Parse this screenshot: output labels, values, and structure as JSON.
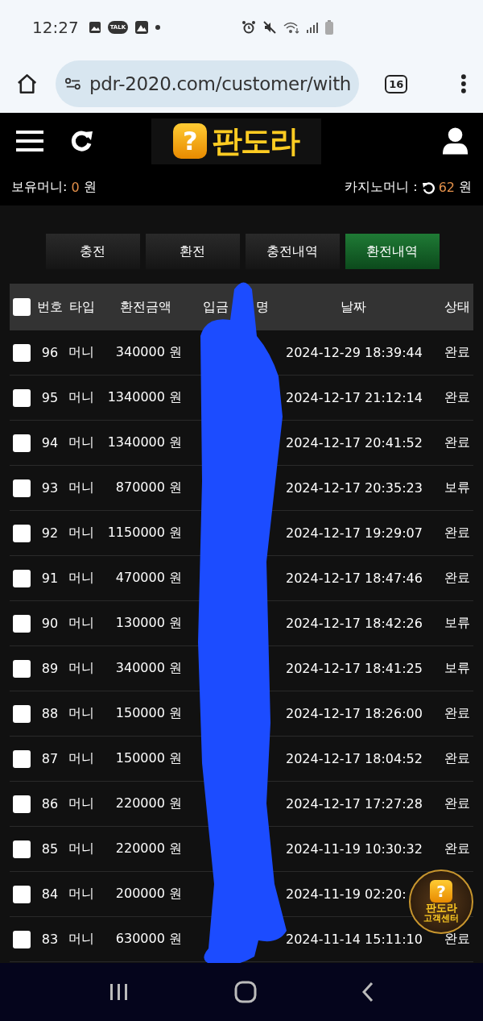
{
  "status_bar": {
    "time": "12:27",
    "chat_badge": "TALK"
  },
  "browser": {
    "url": "pdr-2020.com/customer/with",
    "tab_count": "16"
  },
  "header": {
    "logo": {
      "mark": "?",
      "text": "판도라"
    }
  },
  "balances": {
    "holding_label": "보유머니:",
    "holding_amount": "0",
    "holding_unit": "원",
    "casino_label": "카지노머니 :",
    "casino_amount": "62",
    "casino_unit": "원"
  },
  "tabs": [
    {
      "label": "충전",
      "selected": false
    },
    {
      "label": "환전",
      "selected": false
    },
    {
      "label": "충전내역",
      "selected": false
    },
    {
      "label": "환전내역",
      "selected": true
    }
  ],
  "table": {
    "select_all_checked": false,
    "columns": [
      {
        "label": "번호"
      },
      {
        "label": "타입"
      },
      {
        "label": "환전금액"
      },
      {
        "label_start": "입금",
        "label_end": "명"
      },
      {
        "label": "날짜"
      },
      {
        "label": "상태"
      }
    ],
    "rows": [
      {
        "checked": false,
        "number": "96",
        "type": "머니",
        "amount": "340000 원",
        "date": "2024-12-29 18:39:44",
        "status": "완료"
      },
      {
        "checked": false,
        "number": "95",
        "type": "머니",
        "amount": "1340000 원",
        "date": "2024-12-17 21:12:14",
        "status": "완료"
      },
      {
        "checked": false,
        "number": "94",
        "type": "머니",
        "amount": "1340000 원",
        "date": "2024-12-17 20:41:52",
        "status": "완료"
      },
      {
        "checked": false,
        "number": "93",
        "type": "머니",
        "amount": "870000 원",
        "date": "2024-12-17 20:35:23",
        "status": "보류"
      },
      {
        "checked": false,
        "number": "92",
        "type": "머니",
        "amount": "1150000 원",
        "date": "2024-12-17 19:29:07",
        "status": "완료"
      },
      {
        "checked": false,
        "number": "91",
        "type": "머니",
        "amount": "470000 원",
        "date": "2024-12-17 18:47:46",
        "status": "완료"
      },
      {
        "checked": false,
        "number": "90",
        "type": "머니",
        "amount": "130000 원",
        "date": "2024-12-17 18:42:26",
        "status": "보류"
      },
      {
        "checked": false,
        "number": "89",
        "type": "머니",
        "amount": "340000 원",
        "date": "2024-12-17 18:41:25",
        "status": "보류"
      },
      {
        "checked": false,
        "number": "88",
        "type": "머니",
        "amount": "150000 원",
        "date": "2024-12-17 18:26:00",
        "status": "완료"
      },
      {
        "checked": false,
        "number": "87",
        "type": "머니",
        "amount": "150000 원",
        "date": "2024-12-17 18:04:52",
        "status": "완료"
      },
      {
        "checked": false,
        "number": "86",
        "type": "머니",
        "amount": "220000 원",
        "date": "2024-12-17 17:27:28",
        "status": "완료"
      },
      {
        "checked": false,
        "number": "85",
        "type": "머니",
        "amount": "220000 원",
        "date": "2024-11-19 10:30:32",
        "status": "완료"
      },
      {
        "checked": false,
        "number": "84",
        "type": "머니",
        "amount": "200000 원",
        "date": "2024-11-19 02:20:"
      },
      {
        "checked": false,
        "number": "83",
        "type": "머니",
        "amount": "630000 원",
        "date": "2024-11-14 15:11:10",
        "status": "완료"
      }
    ]
  },
  "support_badge": {
    "mark": "?",
    "title": "판도라",
    "subtitle": "고객센터"
  }
}
